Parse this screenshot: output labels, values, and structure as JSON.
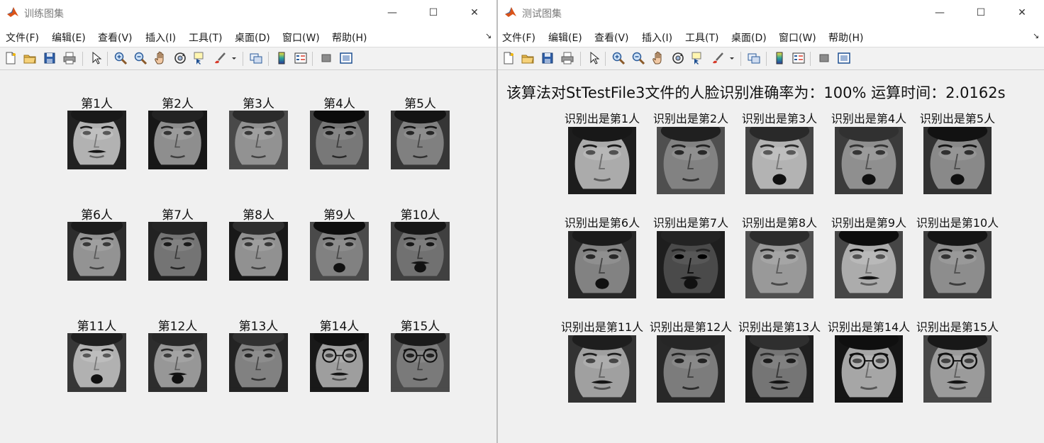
{
  "left_window": {
    "title": "训练图集",
    "controls": {
      "minimize": "—",
      "maximize": "☐",
      "close": "✕"
    },
    "menu": [
      "文件(F)",
      "编辑(E)",
      "查看(V)",
      "插入(I)",
      "工具(T)",
      "桌面(D)",
      "窗口(W)",
      "帮助(H)"
    ],
    "menu_arrow": "↘",
    "labels": [
      "第1人",
      "第2人",
      "第3人",
      "第4人",
      "第5人",
      "第6人",
      "第7人",
      "第8人",
      "第9人",
      "第10人",
      "第11人",
      "第12人",
      "第13人",
      "第14人",
      "第15人"
    ]
  },
  "right_window": {
    "title": "测试图集",
    "controls": {
      "minimize": "—",
      "maximize": "☐",
      "close": "✕"
    },
    "menu": [
      "文件(F)",
      "编辑(E)",
      "查看(V)",
      "插入(I)",
      "工具(T)",
      "桌面(D)",
      "窗口(W)",
      "帮助(H)"
    ],
    "menu_arrow": "↘",
    "result_text": "该算法对StTestFile3文件的人脸识别准确率为：100% 运算时间：2.0162s",
    "labels": [
      "识别出是第1人",
      "识别出是第2人",
      "识别出是第3人",
      "识别出是第4人",
      "识别出是第5人",
      "识别出是第6人",
      "识别出是第7人",
      "识别出是第8人",
      "识别出是第9人",
      "识别出是第10人",
      "识别出是第11人",
      "识别出是第12人",
      "识别出是第13人",
      "识别出是第14人",
      "识别出是第15人"
    ]
  },
  "toolbar_icons": [
    "new-figure-icon",
    "open-file-icon",
    "save-icon",
    "print-icon",
    "edit-plot-icon",
    "zoom-in-icon",
    "zoom-out-icon",
    "pan-icon",
    "rotate-3d-icon",
    "data-cursor-icon",
    "brush-icon",
    "link-plot-icon",
    "colorbar-icon",
    "legend-icon",
    "hide-plot-tools-icon",
    "show-plot-tools-icon"
  ],
  "colors": {
    "accent": "#d95319",
    "window_bg": "#f0f0f0",
    "title_bar": "#ffffff"
  }
}
